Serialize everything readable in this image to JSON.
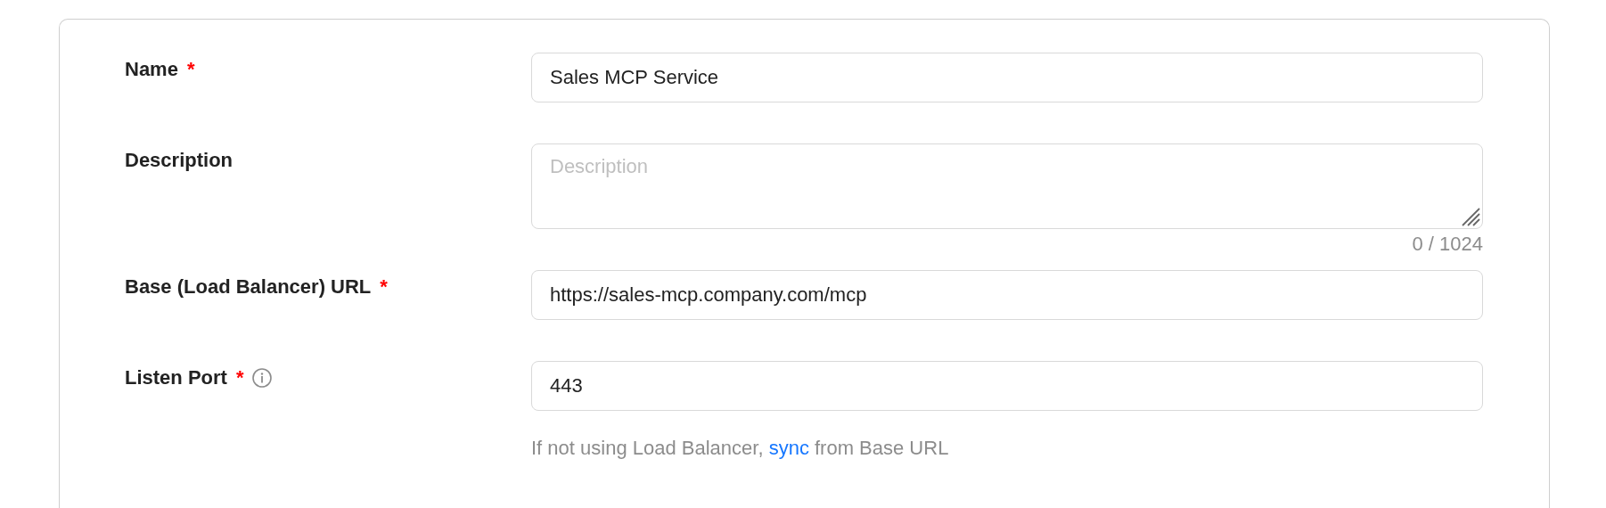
{
  "fields": [
    {
      "kind": "input",
      "label": "Name",
      "required_mark": "*",
      "info": false,
      "value": "Sales MCP Service"
    },
    {
      "kind": "textarea",
      "label": "Description",
      "info": false,
      "placeholder": "Description",
      "counter": "0 / 1024"
    },
    {
      "kind": "input",
      "label": "Base (Load Balancer) URL",
      "required_mark": "*",
      "info": false,
      "value": "https://sales-mcp.company.com/mcp"
    },
    {
      "kind": "input",
      "label": "Listen Port",
      "required_mark": "*",
      "info": true,
      "value": "443",
      "help": {
        "before": "If not using Load Balancer, ",
        "link": "sync",
        "after": " from Base URL"
      }
    }
  ]
}
